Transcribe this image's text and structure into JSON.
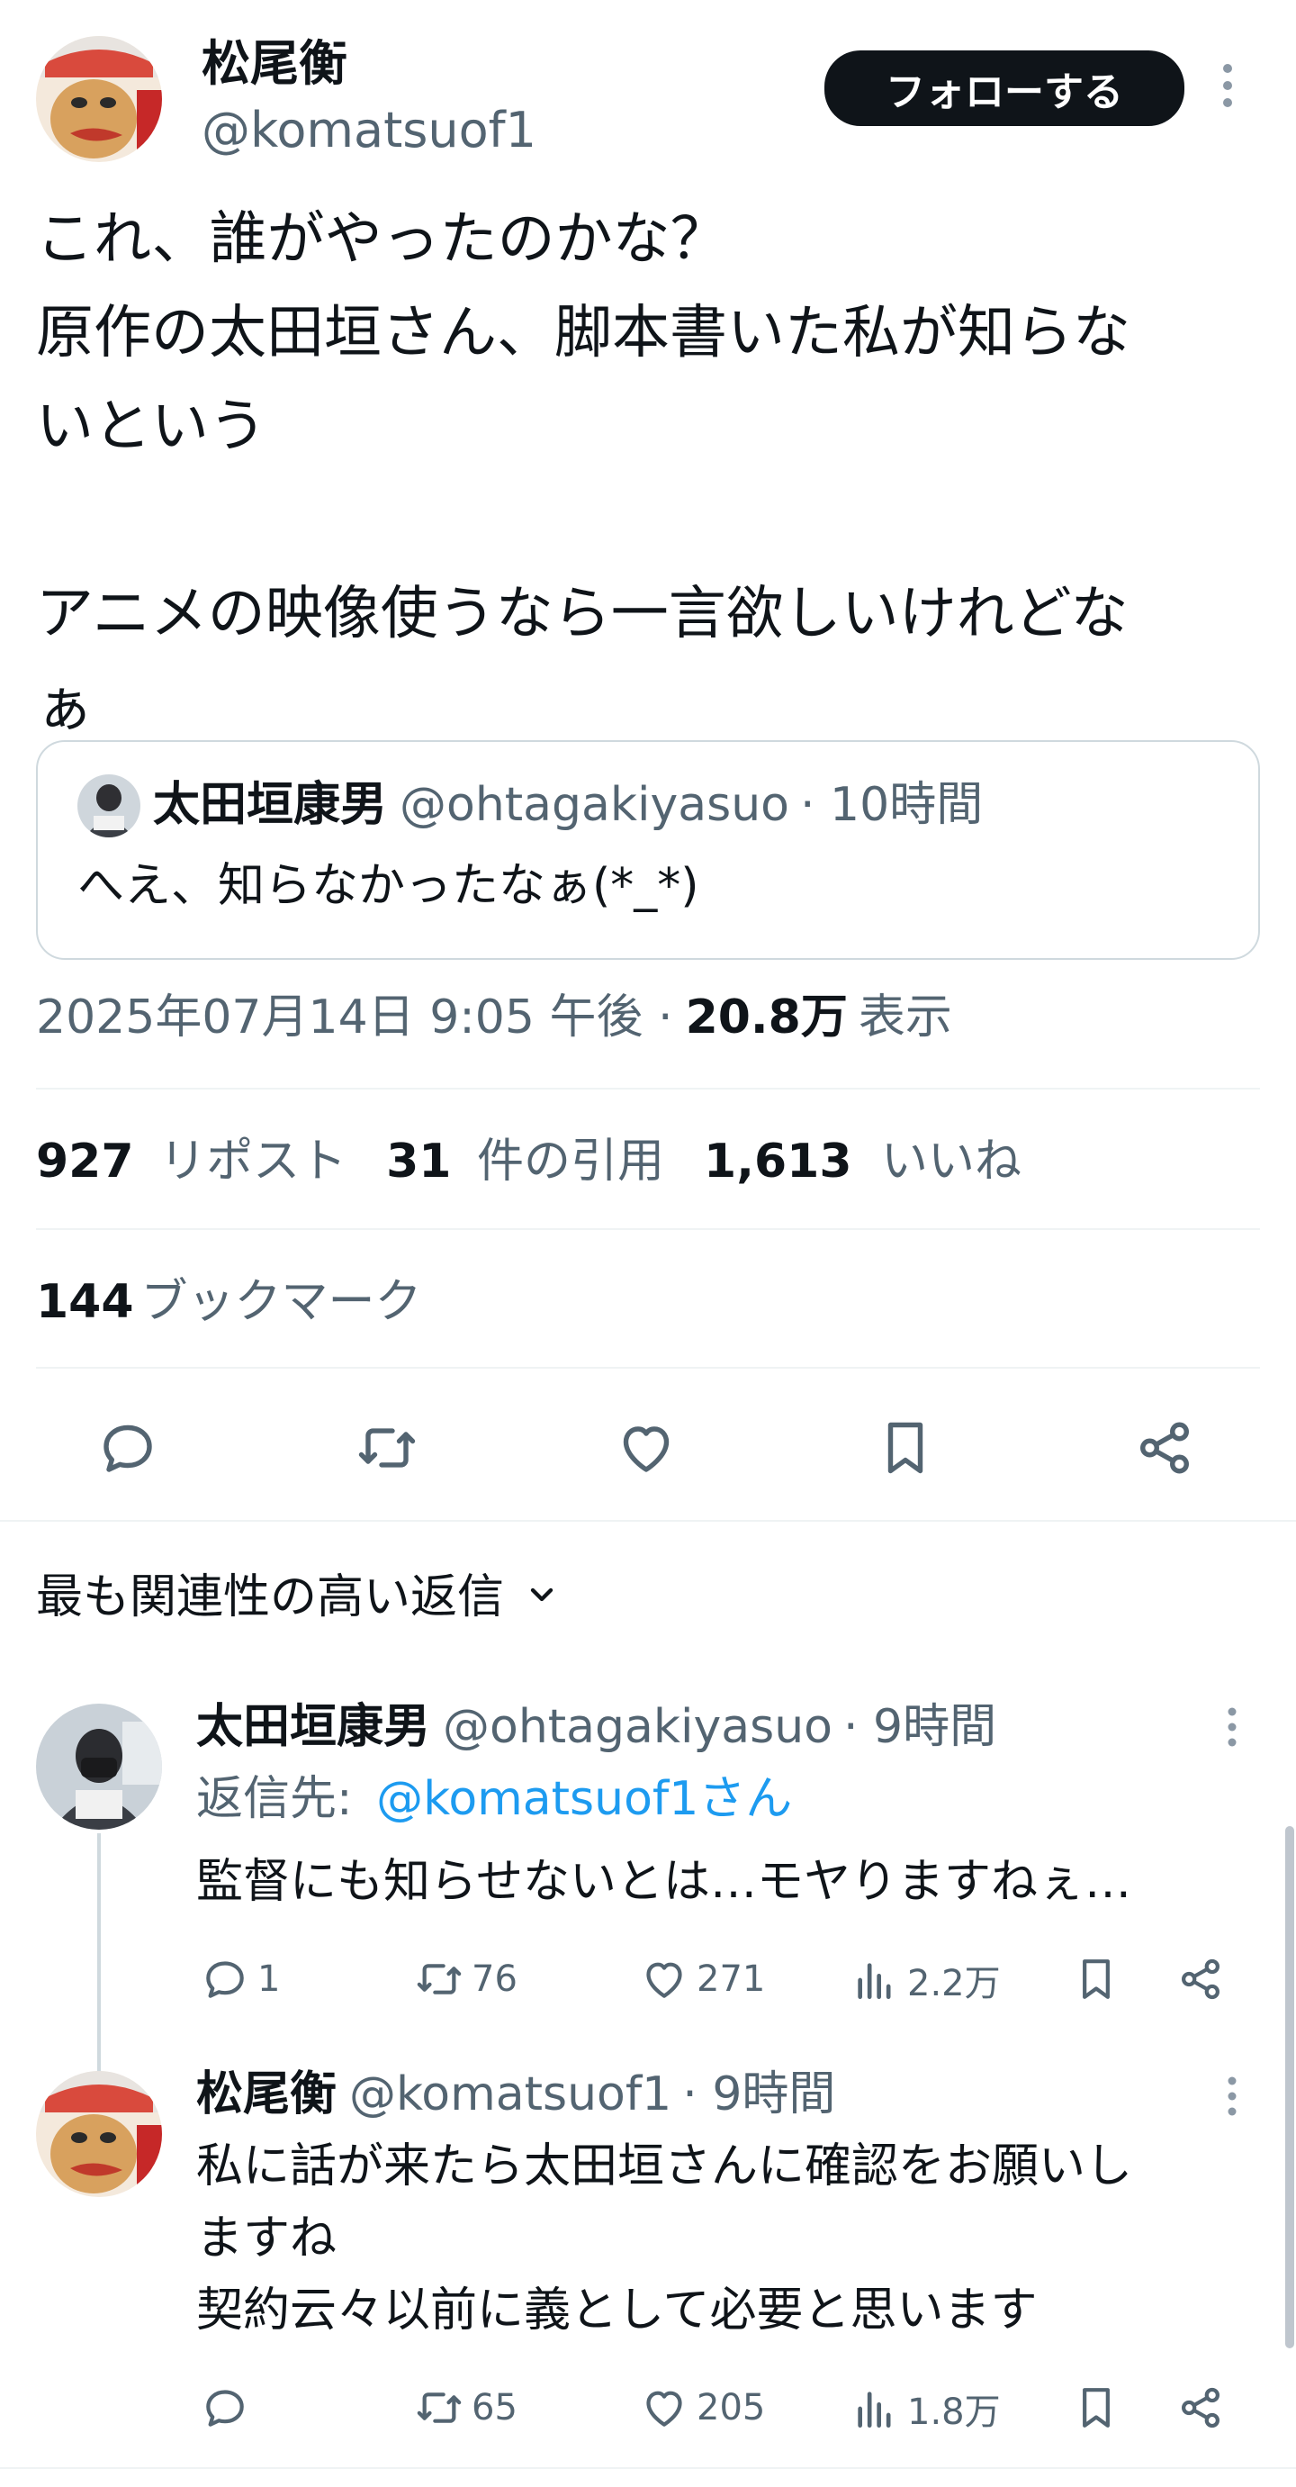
{
  "author": {
    "name": "松尾衡",
    "handle": "@komatsuof1",
    "follow_label": "フォローする"
  },
  "tweet": {
    "text": "これ、誰がやったのかな？\n原作の太田垣さん、脚本書いた私が知らな\nいという\n\nアニメの映像使うなら一言欲しいけれどな\nぁ"
  },
  "quote": {
    "name": "太田垣康男",
    "handle": "@ohtagakiyasuo",
    "time": "· 10時間",
    "text": "へえ、知らなかったなぁ(*_*)"
  },
  "meta": {
    "timestamp": "2025年07月14日 9:05 午後 ·",
    "views_count": "20.8万",
    "views_label": "表示"
  },
  "stats": {
    "reposts_count": "927",
    "reposts_label": "リポスト",
    "quotes_count": "31",
    "quotes_label": "件の引用",
    "likes_count": "1,613",
    "likes_label": "いいね",
    "bookmarks_count": "144",
    "bookmarks_label": "ブックマーク"
  },
  "sort": {
    "label": "最も関連性の高い返信"
  },
  "replies": [
    {
      "name": "太田垣康男",
      "handle": "@ohtagakiyasuo",
      "time": "· 9時間",
      "reply_to_prefix": "返信先: ",
      "reply_to_handle": "@komatsuof1さん",
      "text": "監督にも知らせないとは…モヤりますねぇ…",
      "replies": "1",
      "reposts": "76",
      "likes": "271",
      "views": "2.2万"
    },
    {
      "name": "松尾衡",
      "handle": "@komatsuof1",
      "time": "· 9時間",
      "text": "私に話が来たら太田垣さんに確認をお願いし\nますね\n契約云々以前に義として必要と思います",
      "replies": "",
      "reposts": "65",
      "likes": "205",
      "views": "1.8万"
    }
  ],
  "colors": {
    "text": "#0f1419",
    "secondary": "#536471",
    "link": "#1d9bf0",
    "border": "#eff3f4"
  },
  "icons": [
    "more-icon",
    "reply-icon",
    "repost-icon",
    "like-icon",
    "bookmark-icon",
    "share-icon",
    "views-icon",
    "chevron-down-icon"
  ]
}
